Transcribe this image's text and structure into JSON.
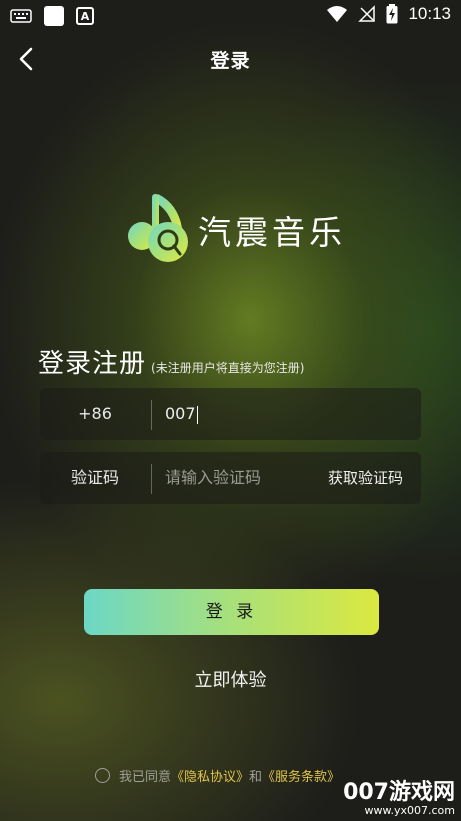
{
  "status_bar": {
    "time": "10:13",
    "notification_icon_letter": "A"
  },
  "header": {
    "title": "登录"
  },
  "logo": {
    "name": "汽震音乐"
  },
  "register": {
    "title": "登录注册",
    "hint": "(未注册用户将直接为您注册)"
  },
  "phone_field": {
    "country_code": "+86",
    "value": "007"
  },
  "code_field": {
    "label": "验证码",
    "placeholder": "请输入验证码",
    "get_code": "获取验证码"
  },
  "login_button": {
    "label": "登 录"
  },
  "try_now": {
    "label": "立即体验"
  },
  "agreement": {
    "prefix": "我已同意",
    "privacy": "《隐私协议》",
    "and": "和",
    "terms": "《服务条款》"
  },
  "watermark": {
    "line1": "007游戏网",
    "line2": "www.yx007.com"
  },
  "colors": {
    "accent_start": "#6cd7c6",
    "accent_end": "#dbe93f",
    "link": "#e0c34a"
  }
}
